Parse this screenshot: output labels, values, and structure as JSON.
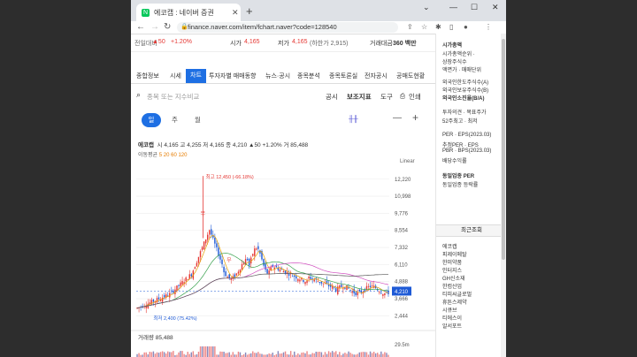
{
  "browser": {
    "tab_title": "에코캡 : 네이버 증권",
    "favicon_letter": "N",
    "tab_close": "✕",
    "new_tab": "+",
    "url": "finance.naver.com/item/fchart.naver?code=128540",
    "controls": {
      "minimize": "—",
      "maximize": "☐",
      "close": "✕",
      "dropdown": "⌄"
    }
  },
  "summary": {
    "change_label": "전일대비",
    "change_value": "▲50",
    "change_pct": "+1.20%",
    "high_label": "시가",
    "high_value": "4,165",
    "low_label": "저가",
    "low_value": "4,165",
    "low_limit": "(하한가 2,915)",
    "amount_label": "거래대금",
    "amount_value": "360 백만"
  },
  "menu": [
    "종합정보",
    "시세",
    "차트",
    "투자자별 매매동향",
    "뉴스·공시",
    "종목분석",
    "종목토론실",
    "전자공시",
    "공매도현황"
  ],
  "search": {
    "placeholder": "종목 또는 지수비교",
    "options": [
      "공시",
      "보조지표",
      "도구",
      "인쇄"
    ]
  },
  "periods": [
    "일",
    "주",
    "월"
  ],
  "info": {
    "name": "에코캡",
    "text": "시 4,165 고 4,255 저 4,165 종 4,210 ▲50 +1.20% 거 85,488"
  },
  "ma": {
    "label": "이동평균",
    "values": "5 20 60 120"
  },
  "scale": "Linear",
  "chart_data": {
    "type": "candlestick",
    "y_ticks": [
      12220,
      10998,
      9776,
      8554,
      7332,
      6110,
      4888,
      3666,
      2444
    ],
    "y_tick_labels": [
      "12,220",
      "10,998",
      "9,776",
      "8,554",
      "7,332",
      "6,110",
      "4,888",
      "3,666",
      "2,444"
    ],
    "ylim": [
      1900,
      12900
    ],
    "last_price": 4210,
    "last_price_label": "4,210",
    "max_label": "최고 12,450 (-66.18%)",
    "max_value": 12450,
    "min_label": "최저 2,400 (75.42%)",
    "min_value": 2400,
    "markers": [
      "무",
      "무"
    ],
    "volume_label": "거래량",
    "volume_value": "85,488",
    "volume_tick": "29.5m"
  },
  "side": {
    "items": [
      "시가총액",
      "시가총액순위 ·",
      "상장주식수",
      "액면가 · 매매단위",
      "외국인한도주식수(A)",
      "외국인보유주식수(B)",
      "외국인소진율(B/A)",
      "투자의견 · 목표주가",
      "52주최고 · 최저",
      "PER · EPS(2023.03)",
      "추정PER · EPS",
      "PBR · BPS(2023.03)",
      "배당수익률",
      "동일업종 PER",
      "동일업종 등락률"
    ],
    "recent_header": "최근조회",
    "recent": [
      "에코캡",
      "피제이메탈",
      "한미약품",
      "인터지스",
      "GH신소재",
      "한컴산업",
      "티피씨글로벌",
      "휴튼스제약",
      "시큐브",
      "티에스이",
      "알서포트"
    ]
  }
}
